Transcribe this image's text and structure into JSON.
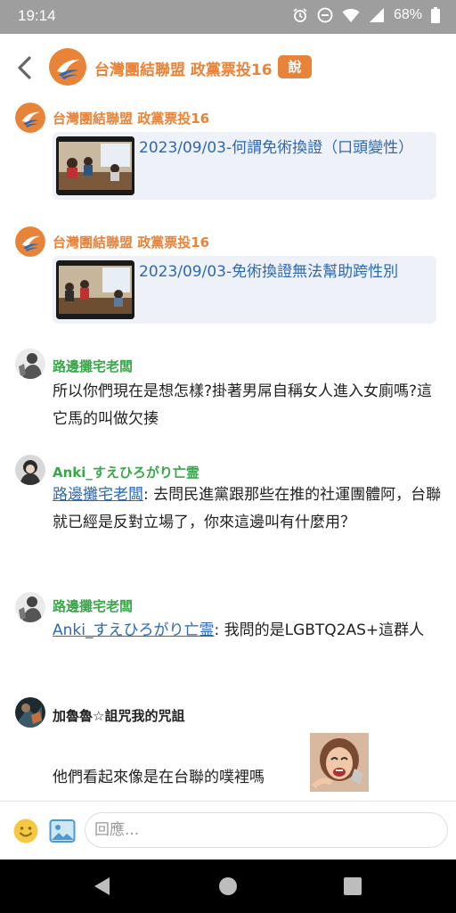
{
  "status_bar": {
    "time": "19:14",
    "battery": "68%"
  },
  "header": {
    "title": "台灣團結聯盟 政黨票投16",
    "badge": "說"
  },
  "posts": [
    {
      "author": "台灣團結聯盟 政黨票投16",
      "link_title": "2023/09/03-何謂免術換證（口頭變性）"
    },
    {
      "author": "台灣團結聯盟 政黨票投16",
      "link_title": "2023/09/03-免術換證無法幫助跨性別"
    },
    {
      "author": "路邊攤宅老闆",
      "text": "所以你們現在是想怎樣?掛著男屌自稱女人進入女廁嗎?這它馬的叫做欠揍"
    },
    {
      "author": "Anki_すえひろがり亡霊",
      "mention": "路邊攤宅老闆",
      "text": ": 去問民進黨跟那些在推的社運團體阿，台聯就已經是反對立場了，你來這邊叫有什麼用？"
    },
    {
      "author": "路邊攤宅老闆",
      "mention": "Anki_すえひろがり亡霊",
      "text": ": 我問的是LGBTQ2AS+這群人"
    },
    {
      "author": "加魯魯☆詛咒我的咒詛",
      "text": "他們看起來像是在台聯的噗裡嗎"
    }
  ],
  "reply": {
    "placeholder": "回應..."
  },
  "icons": {
    "back": "chevron-left-icon",
    "emoji": "smiley-icon",
    "image": "image-icon",
    "alarm": "alarm-icon",
    "dnd": "do-not-disturb-icon",
    "wifi": "wifi-icon",
    "signal": "signal-icon",
    "battery": "battery-icon"
  },
  "colors": {
    "accent": "#e8833a",
    "link": "#2d69b2",
    "plurker_green": "#3aa84a",
    "card_bg": "#eef1f7"
  }
}
